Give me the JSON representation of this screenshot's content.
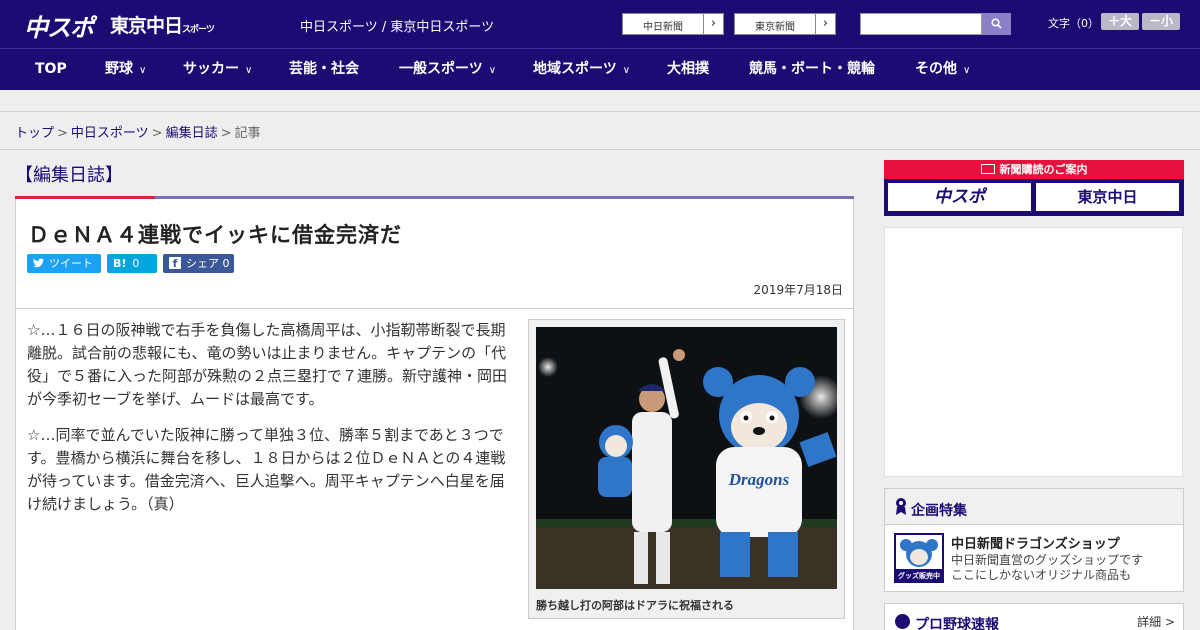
{
  "header": {
    "logo_chuspo": "中スポ",
    "logo_tokyo": "東京中日",
    "logo_tokyo_suffix": "スポーツ",
    "site_title": "中日スポーツ / 東京中日スポーツ",
    "ext_links": [
      "中日新聞",
      "東京新聞"
    ],
    "search_placeholder": "",
    "fontsize_label": "文字（0）",
    "fontsize_up": "＋大",
    "fontsize_down": "－小"
  },
  "nav": {
    "items": [
      "TOP",
      "野球",
      "サッカー",
      "芸能・社会",
      "一般スポーツ",
      "地域スポーツ",
      "大相撲",
      "競馬・ボート・競輪",
      "その他"
    ]
  },
  "breadcrumb": {
    "items": [
      "トップ",
      "中日スポーツ",
      "編集日誌",
      "記事"
    ],
    "sep": ">"
  },
  "article": {
    "section": "【編集日誌】",
    "headline": "ＤｅＮＡ４連戦でイッキに借金完済だ",
    "share": {
      "tweet": "ツイート",
      "hatena_icon": "B!",
      "hatena_count": "0",
      "fb_icon": "f",
      "fb_label": "シェア 0"
    },
    "date": "2019年7月18日",
    "paragraphs": [
      "☆…１６日の阪神戦で右手を負傷した高橋周平は、小指靭帯断裂で長期離脱。試合前の悲報にも、竜の勢いは止まりません。キャプテンの「代役」で５番に入った阿部が殊勲の２点三塁打で７連勝。新守護神・岡田が今季初セーブを挙げ、ムードは最高です。",
      "☆…同率で並んでいた阪神に勝って単独３位、勝率５割まであと３つです。豊橋から横浜に舞台を移し、１８日からは２位ＤｅＮＡとの４連戦が待っています。借金完済へ、巨人追撃へ。周平キャプテンへ白星を届け続けましょう。（真）"
    ],
    "photo_caption": "勝ち越し打の阿部はドアラに祝福される"
  },
  "sidebar": {
    "subscribe_title": "新聞購読のご案内",
    "subscribe_a": "中スポ",
    "subscribe_b": "東京中日",
    "feature_title": "企画特集",
    "feature_name": "中日新聞ドラゴンズショップ",
    "feature_desc_1": "中日新聞直営のグッズショップです",
    "feature_desc_2": "ここにしかないオリジナル商品も",
    "feature_thumb_text": "グッズ販売中",
    "score_title": "プロ野球速報",
    "score_more": "詳細 >"
  },
  "colors": {
    "brand_navy": "#1a0c73",
    "accent_red": "#d7263d",
    "twitter": "#1da1f2",
    "hatena": "#00a4de",
    "facebook": "#3b5998"
  }
}
